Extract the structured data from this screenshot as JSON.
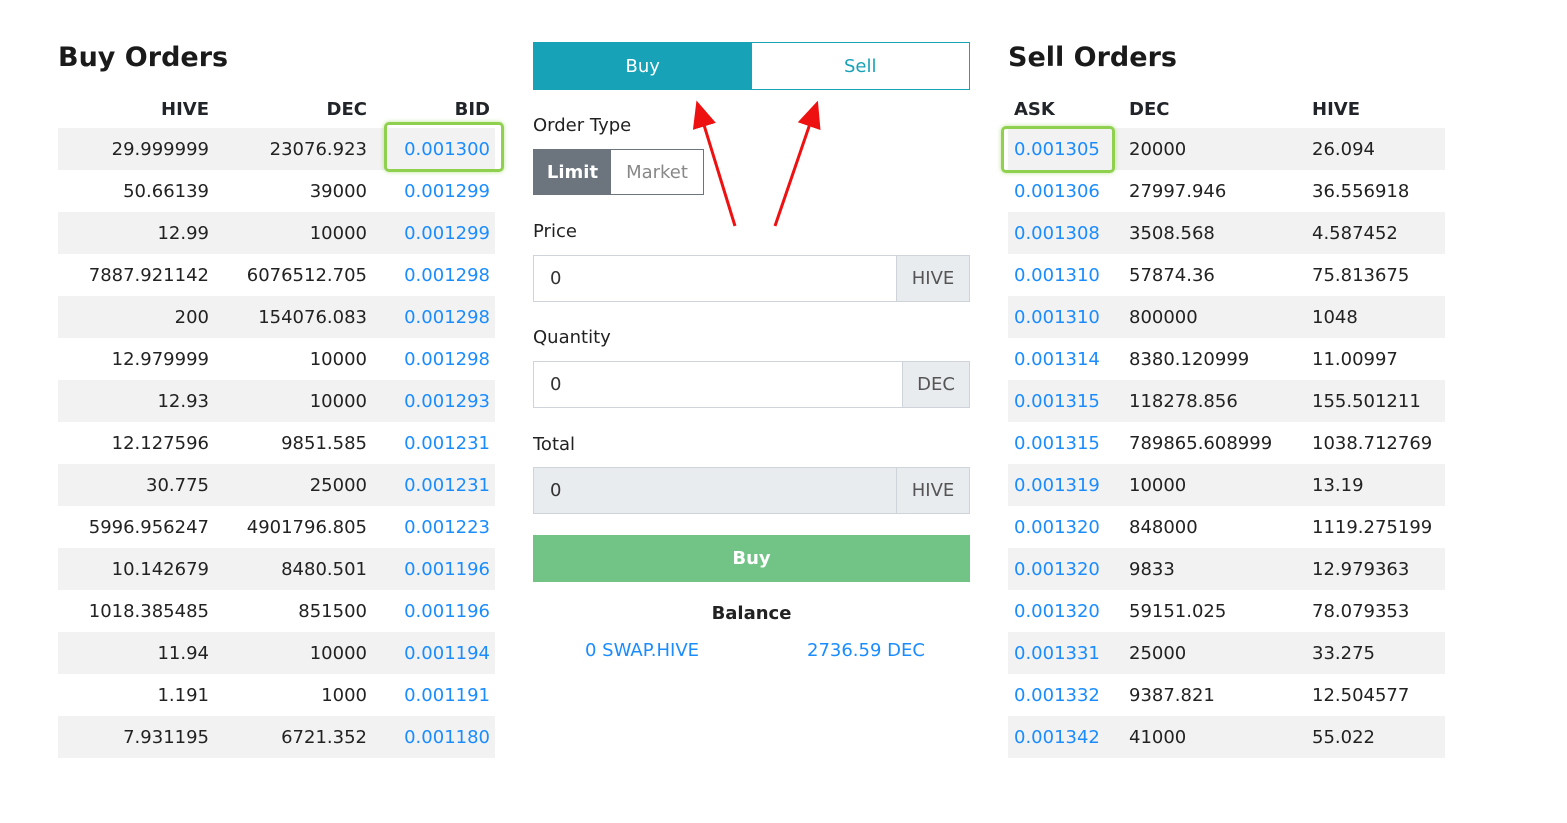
{
  "buy_orders": {
    "title": "Buy Orders",
    "headers": [
      "HIVE",
      "DEC",
      "BID"
    ],
    "rows": [
      [
        "29.999999",
        "23076.923",
        "0.001300"
      ],
      [
        "50.66139",
        "39000",
        "0.001299"
      ],
      [
        "12.99",
        "10000",
        "0.001299"
      ],
      [
        "7887.921142",
        "6076512.705",
        "0.001298"
      ],
      [
        "200",
        "154076.083",
        "0.001298"
      ],
      [
        "12.979999",
        "10000",
        "0.001298"
      ],
      [
        "12.93",
        "10000",
        "0.001293"
      ],
      [
        "12.127596",
        "9851.585",
        "0.001231"
      ],
      [
        "30.775",
        "25000",
        "0.001231"
      ],
      [
        "5996.956247",
        "4901796.805",
        "0.001223"
      ],
      [
        "10.142679",
        "8480.501",
        "0.001196"
      ],
      [
        "1018.385485",
        "851500",
        "0.001196"
      ],
      [
        "11.94",
        "10000",
        "0.001194"
      ],
      [
        "1.191",
        "1000",
        "0.001191"
      ],
      [
        "7.931195",
        "6721.352",
        "0.001180"
      ]
    ]
  },
  "sell_orders": {
    "title": "Sell Orders",
    "headers": [
      "ASK",
      "DEC",
      "HIVE"
    ],
    "rows": [
      [
        "0.001305",
        "20000",
        "26.094"
      ],
      [
        "0.001306",
        "27997.946",
        "36.556918"
      ],
      [
        "0.001308",
        "3508.568",
        "4.587452"
      ],
      [
        "0.001310",
        "57874.36",
        "75.813675"
      ],
      [
        "0.001310",
        "800000",
        "1048"
      ],
      [
        "0.001314",
        "8380.120999",
        "11.00997"
      ],
      [
        "0.001315",
        "118278.856",
        "155.501211"
      ],
      [
        "0.001315",
        "789865.608999",
        "1038.712769"
      ],
      [
        "0.001319",
        "10000",
        "13.19"
      ],
      [
        "0.001320",
        "848000",
        "1119.275199"
      ],
      [
        "0.001320",
        "9833",
        "12.979363"
      ],
      [
        "0.001320",
        "59151.025",
        "78.079353"
      ],
      [
        "0.001331",
        "25000",
        "33.275"
      ],
      [
        "0.001332",
        "9387.821",
        "12.504577"
      ],
      [
        "0.001342",
        "41000",
        "55.022"
      ]
    ]
  },
  "form": {
    "tabs": {
      "buy": "Buy",
      "sell": "Sell",
      "active": "buy"
    },
    "order_type_label": "Order Type",
    "order_type": {
      "limit": "Limit",
      "market": "Market",
      "active": "limit"
    },
    "price": {
      "label": "Price",
      "value": "0",
      "unit": "HIVE"
    },
    "quantity": {
      "label": "Quantity",
      "value": "0",
      "unit": "DEC"
    },
    "total": {
      "label": "Total",
      "value": "0",
      "unit": "HIVE"
    },
    "submit_label": "Buy",
    "balance": {
      "title": "Balance",
      "hive": "0 SWAP.HIVE",
      "dec": "2736.59 DEC"
    }
  },
  "colors": {
    "accent": "#17a2b8",
    "link": "#1a8cff",
    "submit": "#72c486",
    "highlight": "#8fd14f",
    "annotation_arrow": "#ee1111"
  }
}
